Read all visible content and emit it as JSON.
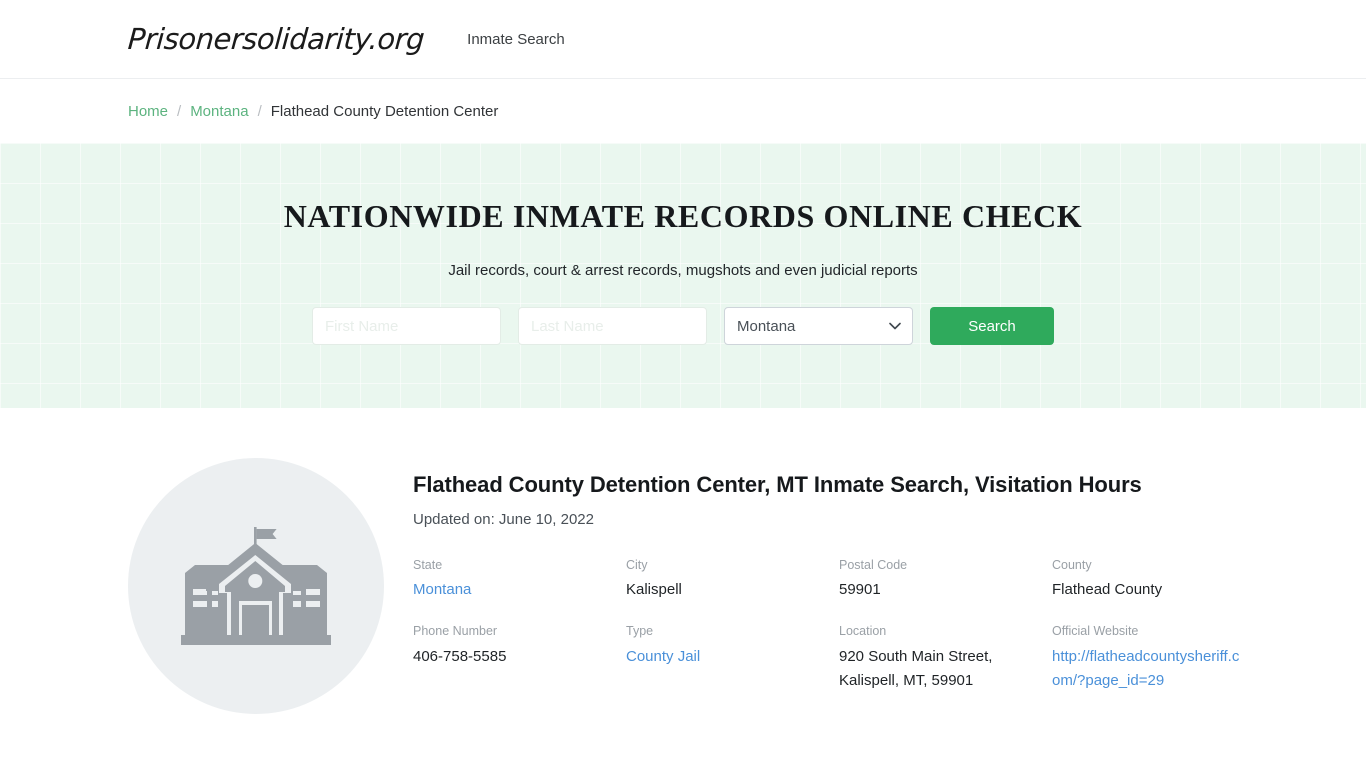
{
  "header": {
    "brand": "Prisonersolidarity.org",
    "nav": [
      {
        "label": "Inmate Search",
        "name": "nav-inmate-search"
      }
    ]
  },
  "breadcrumb": {
    "items": [
      {
        "label": "Home",
        "link": true
      },
      {
        "label": "Montana",
        "link": true
      },
      {
        "label": "Flathead County Detention Center",
        "link": false
      }
    ],
    "separator": "/"
  },
  "hero": {
    "title": "NATIONWIDE INMATE RECORDS ONLINE CHECK",
    "subtitle": "Jail records, court & arrest records, mugshots and even judicial reports",
    "accent_color": "#2faa5c",
    "background_color": "#eaf7ef",
    "form": {
      "first_name": {
        "value": "",
        "placeholder": "First Name"
      },
      "last_name": {
        "value": "",
        "placeholder": "Last Name"
      },
      "state_select": {
        "selected": "Montana",
        "options": [
          "Montana"
        ],
        "icon": "chevron-down-icon"
      },
      "submit_label": "Search"
    }
  },
  "facility": {
    "avatar_icon": "government-building-icon",
    "title": "Flathead County Detention Center, MT Inmate Search, Visitation Hours",
    "updated": "Updated on: June 10, 2022",
    "details": [
      {
        "label": "State",
        "value": "Montana",
        "is_link": true
      },
      {
        "label": "City",
        "value": "Kalispell",
        "is_link": false
      },
      {
        "label": "Postal Code",
        "value": "59901",
        "is_link": false
      },
      {
        "label": "County",
        "value": "Flathead County",
        "is_link": false
      },
      {
        "label": "Phone Number",
        "value": "406-758-5585",
        "is_link": false
      },
      {
        "label": "Type",
        "value": "County Jail",
        "is_link": true
      },
      {
        "label": "Location",
        "value": "920 South Main Street, Kalispell, MT, 59901",
        "is_link": false
      },
      {
        "label": "Official Website",
        "value": "http://flatheadcountysheriff.com/?page_id=29",
        "is_link": true
      }
    ]
  }
}
